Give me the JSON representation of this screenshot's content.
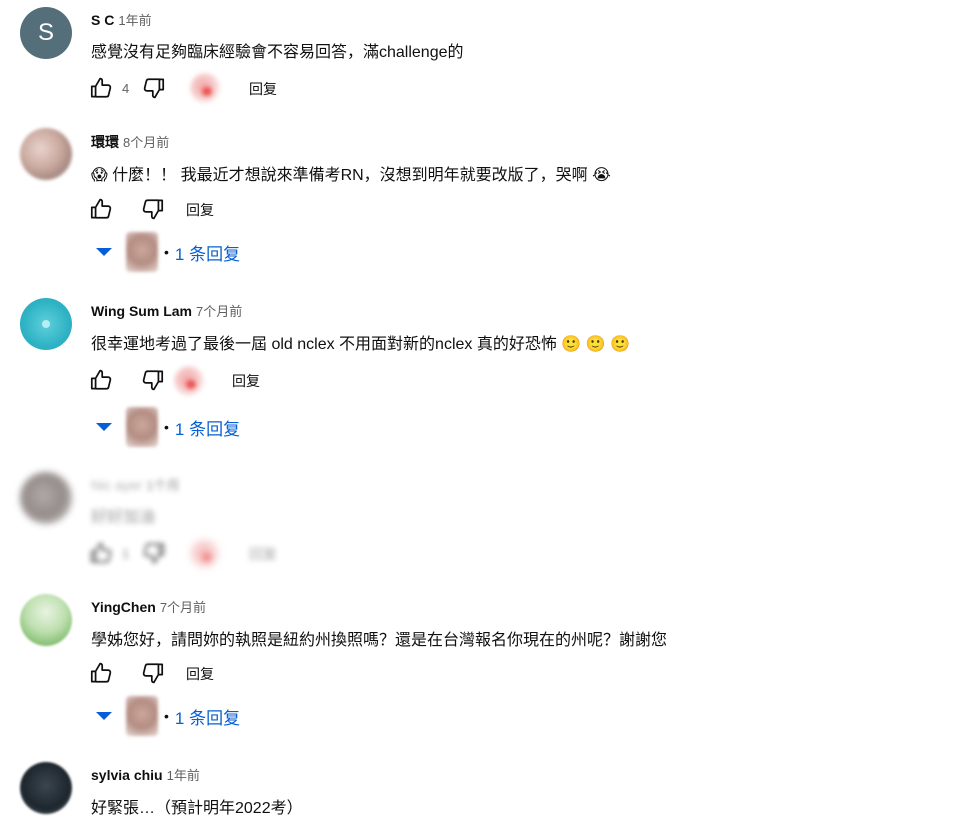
{
  "comments": [
    {
      "author": "S C",
      "time": "1年前",
      "avatar_letter": "S",
      "text": "感覺沒有足夠臨床經驗會不容易回答，滿challenge的",
      "like_count": "4",
      "reply_label": "回复"
    },
    {
      "author": "環環",
      "time": "8个月前",
      "text": "😱 什麼！！ 我最近才想說來準備考RN，沒想到明年就要改版了，哭啊 😭",
      "like_count": "",
      "reply_label": "回复",
      "replies_label": "1 条回复"
    },
    {
      "author": "Wing Sum Lam",
      "time": "7个月前",
      "text": "很幸運地考過了最後一屆 old nclex 不用面對新的nclex 真的好恐怖 🙂 🙂 🙂",
      "like_count": "",
      "reply_label": "回复",
      "replies_label": "1 条回复"
    },
    {
      "author": "Nic ayer",
      "time": "1个月",
      "text": "好好加油",
      "like_count": "1",
      "reply_label": "回复"
    },
    {
      "author": "YingChen",
      "time": "7个月前",
      "text": "學姊您好，請問妳的執照是紐約州換照嗎？還是在台灣報名你現在的州呢？謝謝您",
      "like_count": "",
      "reply_label": "回复",
      "replies_label": "1 条回复"
    },
    {
      "author": "sylvia chiu",
      "time": "1年前",
      "text": "好緊張…（預計明年2022考）"
    }
  ],
  "icons": {
    "like": "thumbs-up-icon",
    "dislike": "thumbs-down-icon",
    "expand": "chevron-down-icon",
    "creator_heart": "creator-heart-icon"
  },
  "colors": {
    "link_blue": "#065fd4",
    "secondary_text": "#606060",
    "avatar_grey": "#546e7a"
  }
}
